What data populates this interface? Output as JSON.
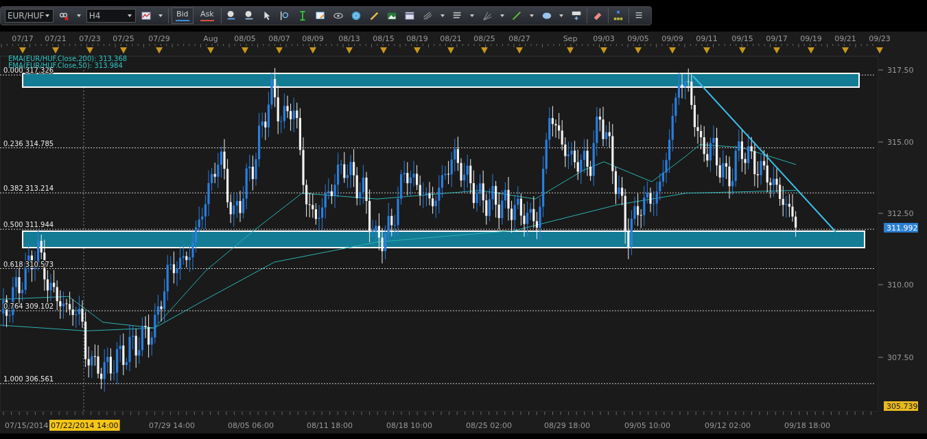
{
  "toolbar": {
    "symbol": "EUR/HUF",
    "timeframe": "H4",
    "quotes": [
      {
        "label": "Bid",
        "selected": true
      },
      {
        "label": "Ask",
        "selected": false
      }
    ]
  },
  "chart": {
    "top_dates": [
      "07/17",
      "07/21",
      "07/23",
      "07/25",
      "07/29",
      "Aug",
      "08/05",
      "08/07",
      "08/09",
      "08/13",
      "08/15",
      "08/19",
      "08/21",
      "08/25",
      "08/27",
      "Sep",
      "09/03",
      "09/05",
      "09/09",
      "09/11",
      "09/15",
      "09/17",
      "09/19",
      "09/21",
      "09/23"
    ],
    "legend": [
      "EMA(EUR/HUF.Close,200): 313.368",
      "EMA(EUR/HUF.Close,50): 313.984"
    ],
    "fib_levels": [
      "0.000 317.326",
      "0.236 314.785",
      "0.382 313.214",
      "0.500 311.944",
      "0.618 310.573",
      "0.764 309.102",
      "1.000 306.561"
    ],
    "price_ticks": [
      "317.50",
      "315.00",
      "312.50",
      "310.00",
      "307.50"
    ],
    "price_markers": [
      {
        "text": "311.992",
        "kind": "current"
      },
      {
        "text": "305.739",
        "kind": "low"
      }
    ],
    "bottom_times": [
      {
        "text": "07/15/2014",
        "highlighted": false
      },
      {
        "text": "07/22/2014 14:00",
        "highlighted": true
      },
      {
        "text": "07/29 14:00",
        "highlighted": false
      },
      {
        "text": "08/05 06:00",
        "highlighted": false
      },
      {
        "text": "08/11 18:00",
        "highlighted": false
      },
      {
        "text": "08/18 10:00",
        "highlighted": false
      },
      {
        "text": "08/25 02:00",
        "highlighted": false
      },
      {
        "text": "08/29 18:00",
        "highlighted": false
      },
      {
        "text": "09/05 10:00",
        "highlighted": false
      },
      {
        "text": "09/12 02:00",
        "highlighted": false
      },
      {
        "text": "09/18 18:00",
        "highlighted": false
      }
    ]
  }
}
